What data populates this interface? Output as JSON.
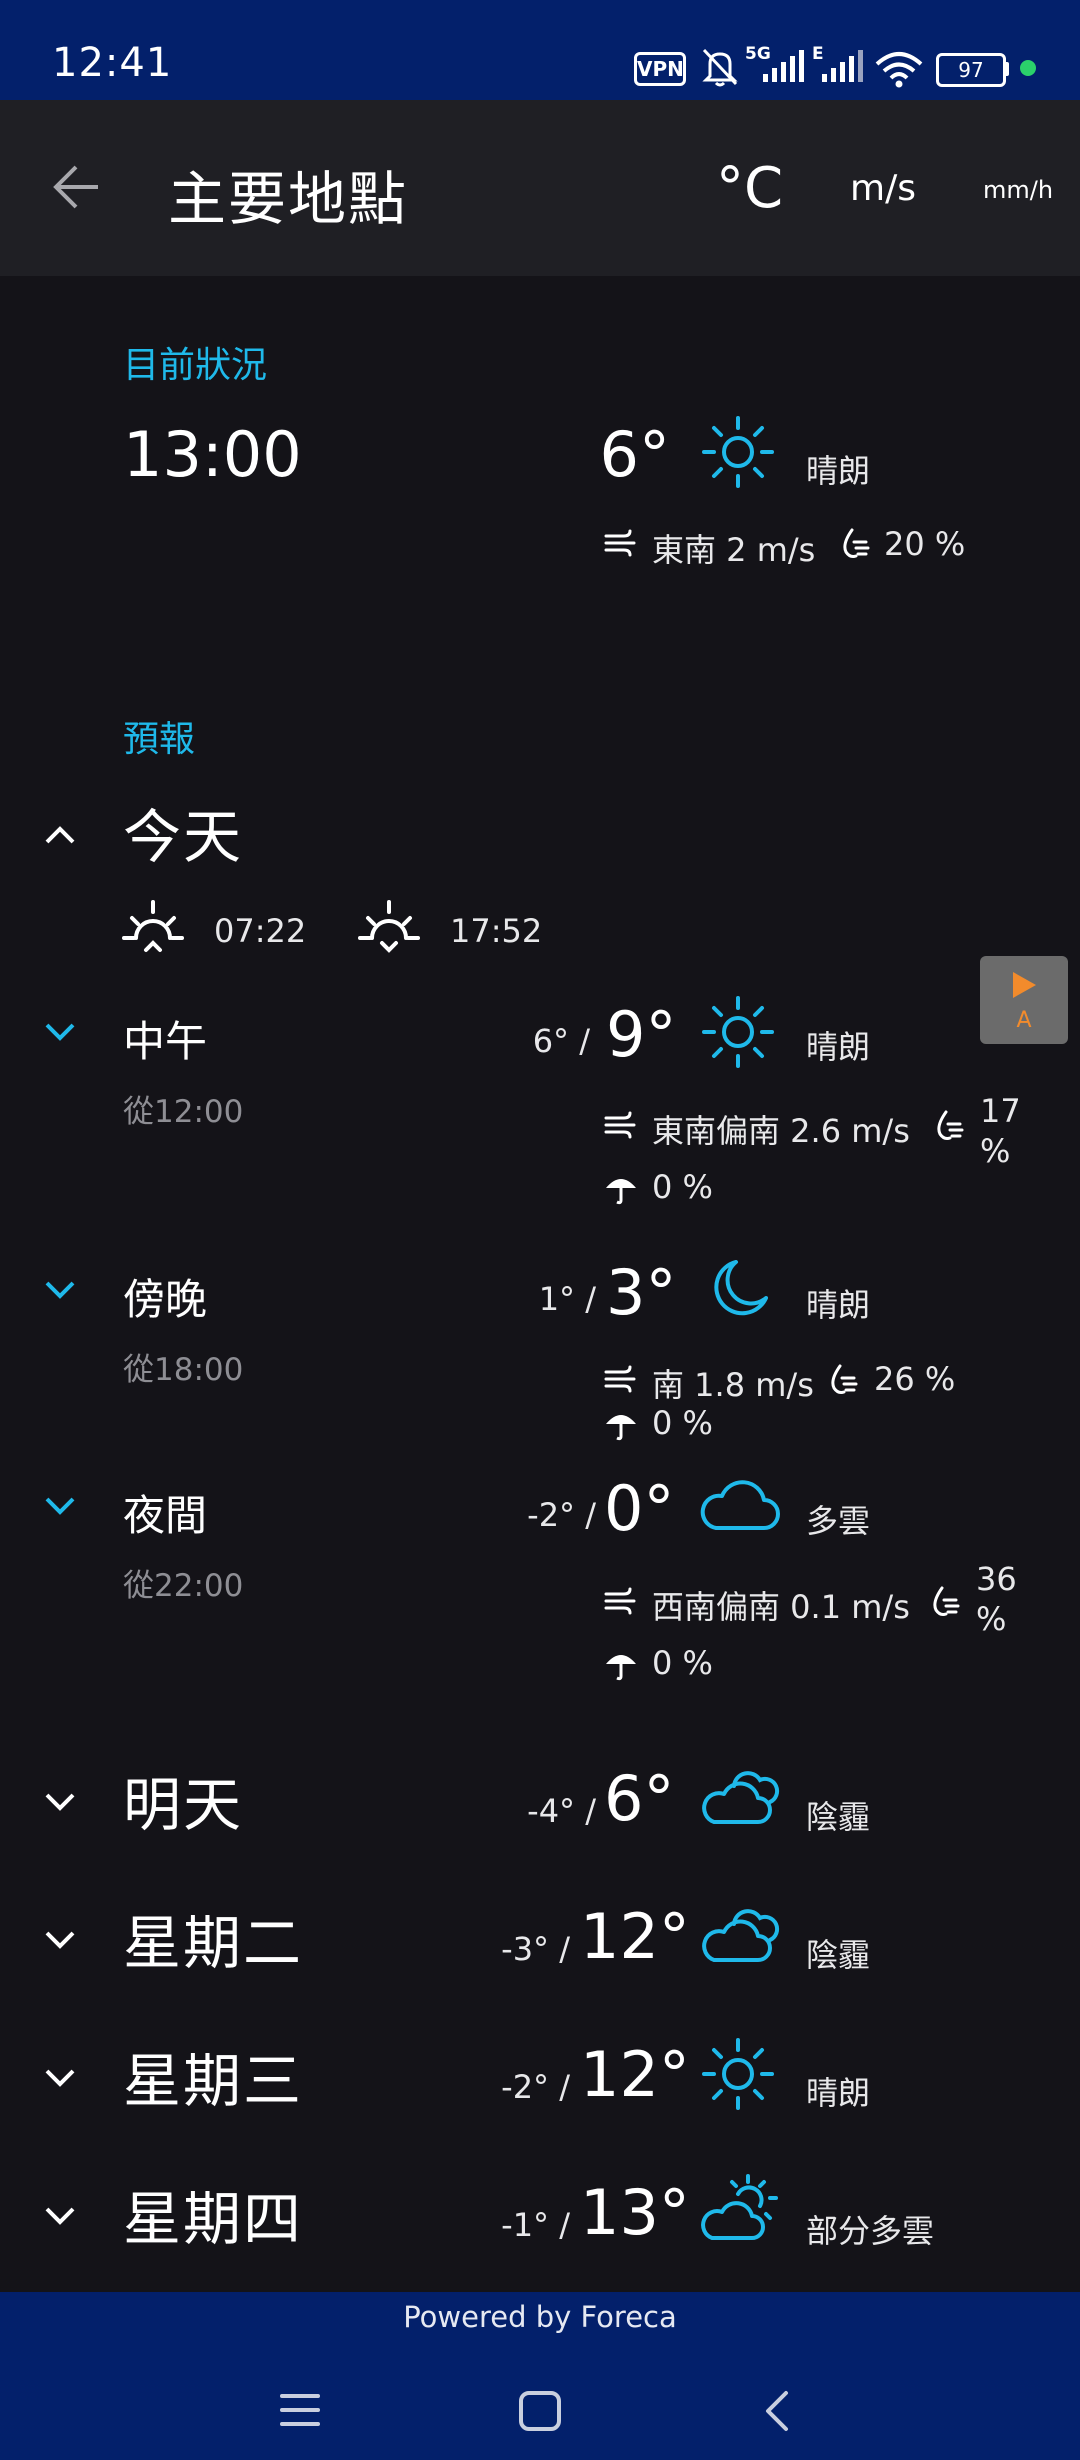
{
  "status_bar": {
    "time": "12:41",
    "vpn": "VPN",
    "network_5g": "5G",
    "network_e": "E",
    "battery": "97",
    "icons": [
      "vpn-icon",
      "mute-bell-icon",
      "signal-5g-icon",
      "signal-e-icon",
      "wifi-icon",
      "battery-icon",
      "dot-icon"
    ]
  },
  "app_bar": {
    "title": "主要地點",
    "unit_temp": "°C",
    "unit_wind": "m/s",
    "unit_rain": "mm/h"
  },
  "current": {
    "label": "目前狀況",
    "time": "13:00",
    "temp": "6°",
    "condition": "晴朗",
    "wind": "東南 2 m/s",
    "humidity": "20 %"
  },
  "forecast": {
    "label": "預報",
    "today": {
      "title": "今天",
      "sunrise": "07:22",
      "sunset": "17:52",
      "periods": [
        {
          "name": "中午",
          "from": "從12:00",
          "low": "6°",
          "high": "9°",
          "condition": "晴朗",
          "icon": "sun-icon",
          "wind": "東南偏南 2.6 m/s",
          "humidity_value": "17",
          "humidity_unit": "%",
          "precip": "0 %"
        },
        {
          "name": "傍晚",
          "from": "從18:00",
          "low": "1°",
          "high": "3°",
          "condition": "晴朗",
          "icon": "moon-icon",
          "wind": "南 1.8 m/s",
          "humidity": "26 %",
          "precip": "0 %"
        },
        {
          "name": "夜間",
          "from": "從22:00",
          "low": "-2°",
          "high": "0°",
          "condition": "多雲",
          "icon": "cloud-icon",
          "wind": "西南偏南 0.1 m/s",
          "humidity_value": "36",
          "humidity_unit": "%",
          "precip": "0 %"
        }
      ]
    },
    "days": [
      {
        "name": "明天",
        "low": "-4°",
        "high": "6°",
        "condition": "陰霾",
        "icon": "clouds-icon"
      },
      {
        "name": "星期二",
        "low": "-3°",
        "high": "12°",
        "condition": "陰霾",
        "icon": "clouds-icon"
      },
      {
        "name": "星期三",
        "low": "-2°",
        "high": "12°",
        "condition": "晴朗",
        "icon": "sun-icon"
      },
      {
        "name": "星期四",
        "low": "-1°",
        "high": "13°",
        "condition": "部分多雲",
        "icon": "partly-cloudy-icon"
      }
    ]
  },
  "ad_badge": "A",
  "footer": {
    "powered": "Powered by Foreca"
  },
  "colors": {
    "accent": "#1fb9ea",
    "background": "#141318",
    "bars": "#03206b",
    "app_bar": "#1f1f24"
  }
}
